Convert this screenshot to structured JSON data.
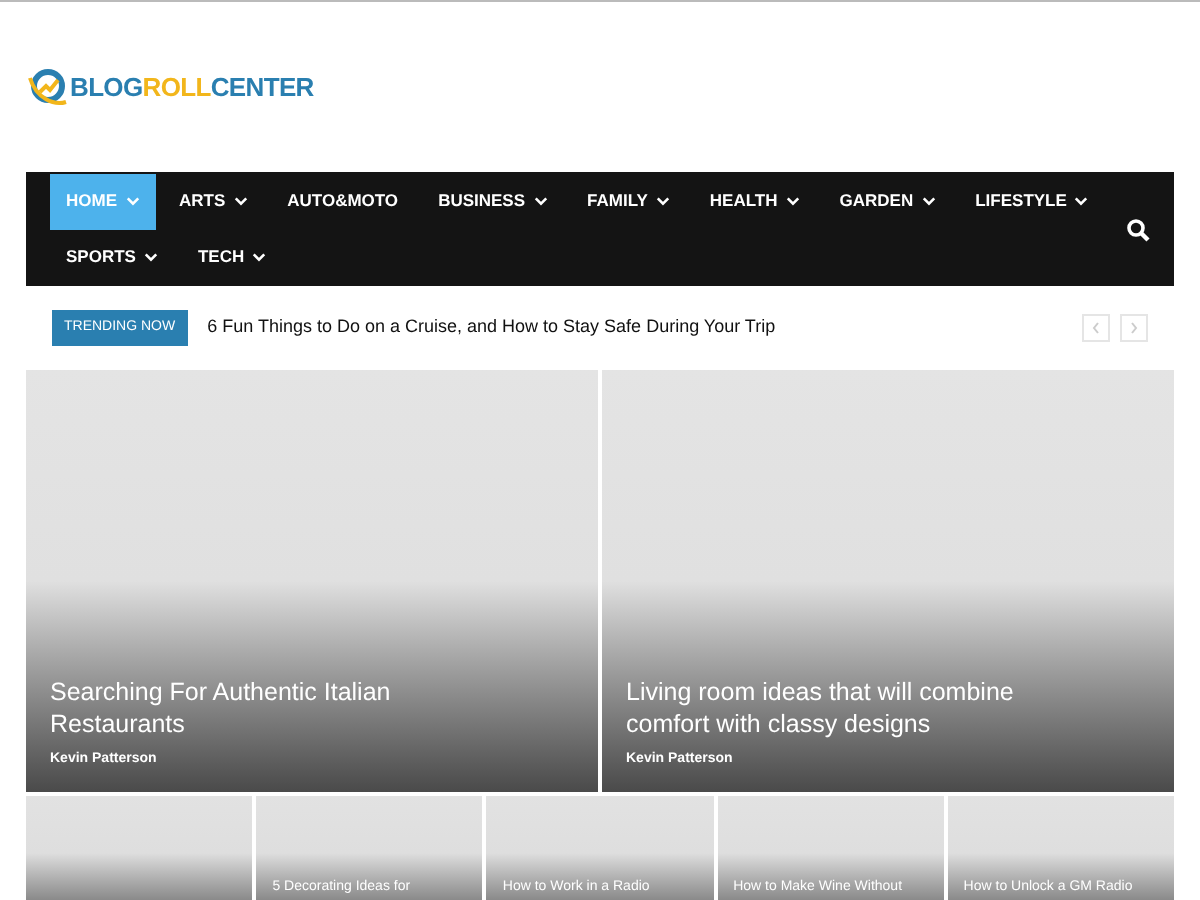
{
  "logo": {
    "part_1": "BLOG",
    "part_2": "ROLL",
    "part_3": "CENTER"
  },
  "nav": {
    "items": [
      {
        "label": "HOME",
        "selected": true,
        "dropdown": true
      },
      {
        "label": "ARTS",
        "selected": false,
        "dropdown": true
      },
      {
        "label": "AUTO&MOTO",
        "selected": false,
        "dropdown": false
      },
      {
        "label": "BUSINESS",
        "selected": false,
        "dropdown": true
      },
      {
        "label": "FAMILY",
        "selected": false,
        "dropdown": true
      },
      {
        "label": "HEALTH",
        "selected": false,
        "dropdown": true
      },
      {
        "label": "GARDEN",
        "selected": false,
        "dropdown": true
      },
      {
        "label": "LIFESTYLE",
        "selected": false,
        "dropdown": true
      },
      {
        "label": "SPORTS",
        "selected": false,
        "dropdown": true
      },
      {
        "label": "TECH",
        "selected": false,
        "dropdown": true
      }
    ]
  },
  "trending": {
    "badge": "TRENDING NOW",
    "headline": "6 Fun Things to Do on a Cruise, and How to Stay Safe During Your Trip"
  },
  "featured": [
    {
      "title": "Searching For Authentic Italian Restaurants",
      "author": "Kevin Patterson"
    },
    {
      "title": "Living room ideas that will combine comfort with classy designs",
      "author": "Kevin Patterson"
    }
  ],
  "small_posts": [
    {
      "kind": "image"
    },
    {
      "kind": "titled",
      "title": "5 Decorating Ideas for"
    },
    {
      "kind": "titled",
      "title": "How to Work in a Radio"
    },
    {
      "kind": "titled",
      "title": "How to Make Wine Without"
    },
    {
      "kind": "titled",
      "title": "How to Unlock a GM Radio"
    }
  ]
}
